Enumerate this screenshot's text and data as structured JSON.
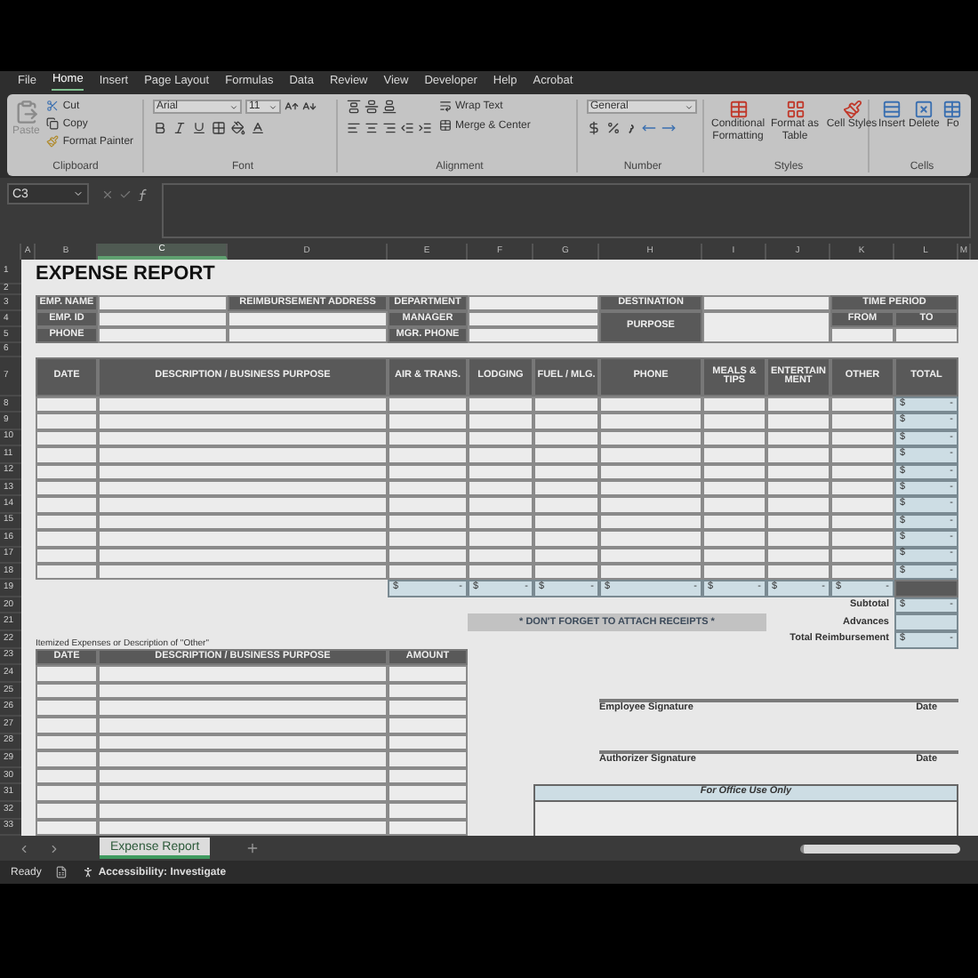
{
  "menu_tabs": [
    {
      "label": "File",
      "selected": false
    },
    {
      "label": "Home",
      "selected": true
    },
    {
      "label": "Insert",
      "selected": false
    },
    {
      "label": "Page Layout",
      "selected": false
    },
    {
      "label": "Formulas",
      "selected": false
    },
    {
      "label": "Data",
      "selected": false
    },
    {
      "label": "Review",
      "selected": false
    },
    {
      "label": "View",
      "selected": false
    },
    {
      "label": "Developer",
      "selected": false
    },
    {
      "label": "Help",
      "selected": false
    },
    {
      "label": "Acrobat",
      "selected": false
    }
  ],
  "ribbon": {
    "clipboard": {
      "paste": "Paste",
      "cut": "Cut",
      "copy": "Copy",
      "format_painter": "Format Painter",
      "label": "Clipboard"
    },
    "font": {
      "name": "Arial",
      "size": "11",
      "label": "Font"
    },
    "alignment": {
      "wrap_text": "Wrap Text",
      "merge": "Merge & Center",
      "label": "Alignment"
    },
    "number": {
      "format": "General",
      "label": "Number"
    },
    "styles": {
      "buttons": [
        "Conditional Formatting",
        "Format as Table",
        "Cell Styles"
      ],
      "label": "Styles"
    },
    "cells": {
      "buttons": [
        "Insert",
        "Delete",
        "Fo"
      ],
      "label": "Cells"
    }
  },
  "formula_bar": {
    "name_box": "C3"
  },
  "columns": [
    {
      "label": "A",
      "selected": false
    },
    {
      "label": "B",
      "selected": false
    },
    {
      "label": "C",
      "selected": true
    },
    {
      "label": "D",
      "selected": false
    },
    {
      "label": "E",
      "selected": false
    },
    {
      "label": "F",
      "selected": false
    },
    {
      "label": "G",
      "selected": false
    },
    {
      "label": "H",
      "selected": false
    },
    {
      "label": "I",
      "selected": false
    },
    {
      "label": "J",
      "selected": false
    },
    {
      "label": "K",
      "selected": false
    },
    {
      "label": "L",
      "selected": false
    },
    {
      "label": "M",
      "selected": false
    }
  ],
  "rows": [
    "1",
    "2",
    "3",
    "4",
    "5",
    "6",
    "7",
    "8",
    "9",
    "10",
    "11",
    "12",
    "13",
    "14",
    "15",
    "16",
    "17",
    "18",
    "19",
    "20",
    "21",
    "22",
    "23",
    "24",
    "25",
    "26",
    "27",
    "28",
    "29",
    "30",
    "31",
    "32",
    "33"
  ],
  "sheet": {
    "title": "EXPENSE REPORT",
    "employee_labels": [
      "EMP. NAME",
      "EMP. ID",
      "PHONE"
    ],
    "address_label": "REIMBURSEMENT ADDRESS",
    "department_labels": [
      "DEPARTMENT",
      "MANAGER",
      "MGR. PHONE"
    ],
    "destination_label": "DESTINATION",
    "purpose_label": "PURPOSE",
    "time_period": {
      "label": "TIME PERIOD",
      "from": "FROM",
      "to": "TO"
    },
    "expense_columns": [
      "DATE",
      "DESCRIPTION / BUSINESS PURPOSE",
      "AIR & TRANS.",
      "LODGING",
      "FUEL / MLG.",
      "PHONE",
      "MEALS & TIPS",
      "ENTERTAINMENT",
      "OTHER",
      "TOTAL"
    ],
    "expense_rows": [
      {
        "currency": "$",
        "amount": "-"
      },
      {
        "currency": "$",
        "amount": "-"
      },
      {
        "currency": "$",
        "amount": "-"
      },
      {
        "currency": "$",
        "amount": "-"
      },
      {
        "currency": "$",
        "amount": "-"
      },
      {
        "currency": "$",
        "amount": "-"
      },
      {
        "currency": "$",
        "amount": "-"
      },
      {
        "currency": "$",
        "amount": "-"
      },
      {
        "currency": "$",
        "amount": "-"
      },
      {
        "currency": "$",
        "amount": "-"
      },
      {
        "currency": "$",
        "amount": "-"
      }
    ],
    "column_totals": [
      {
        "currency": "$",
        "amount": "-"
      },
      {
        "currency": "$",
        "amount": "-"
      },
      {
        "currency": "$",
        "amount": "-"
      },
      {
        "currency": "$",
        "amount": "-"
      },
      {
        "currency": "$",
        "amount": "-"
      },
      {
        "currency": "$",
        "amount": "-"
      },
      {
        "currency": "$",
        "amount": "-"
      }
    ],
    "subtotal": {
      "label": "Subtotal",
      "currency": "$",
      "amount": "-"
    },
    "advances": {
      "label": "Advances"
    },
    "total_reimbursement": {
      "label": "Total Reimbursement",
      "currency": "$",
      "amount": "-"
    },
    "receipt_notice": "* DON'T FORGET TO ATTACH RECEIPTS *",
    "itemized": {
      "caption": "Itemized Expenses or Description of \"Other\"",
      "columns": [
        "DATE",
        "DESCRIPTION / BUSINESS PURPOSE",
        "AMOUNT"
      ]
    },
    "signatures": [
      {
        "label": "Employee Signature",
        "date": "Date"
      },
      {
        "label": "Authorizer Signature",
        "date": "Date"
      }
    ],
    "office_use": "For Office Use Only"
  },
  "sheet_tabs": [
    {
      "label": "Expense Report",
      "selected": true
    }
  ],
  "status_bar": {
    "mode": "Ready",
    "accessibility": "Accessibility: Investigate"
  }
}
